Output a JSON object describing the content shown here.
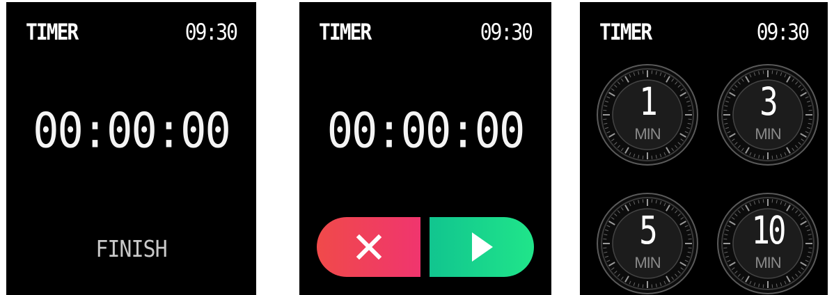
{
  "screens": [
    {
      "title": "TIMER",
      "clock": "09:30",
      "time": "00:00:00",
      "finish_label": "FINISH"
    },
    {
      "title": "TIMER",
      "clock": "09:30",
      "time": "00:00:00",
      "buttons": {
        "cancel_icon": "close-icon",
        "start_icon": "play-icon"
      }
    },
    {
      "title": "TIMER",
      "clock": "09:30",
      "presets": [
        {
          "value": "1",
          "unit": "MIN"
        },
        {
          "value": "3",
          "unit": "MIN"
        },
        {
          "value": "5",
          "unit": "MIN"
        },
        {
          "value": "10",
          "unit": "MIN"
        }
      ]
    }
  ],
  "colors": {
    "background": "#000000",
    "cancel_gradient": [
      "#f04a4a",
      "#f0356e"
    ],
    "start_gradient": [
      "#11c58f",
      "#20e58a"
    ],
    "dial_face": "#1c1c1c"
  }
}
